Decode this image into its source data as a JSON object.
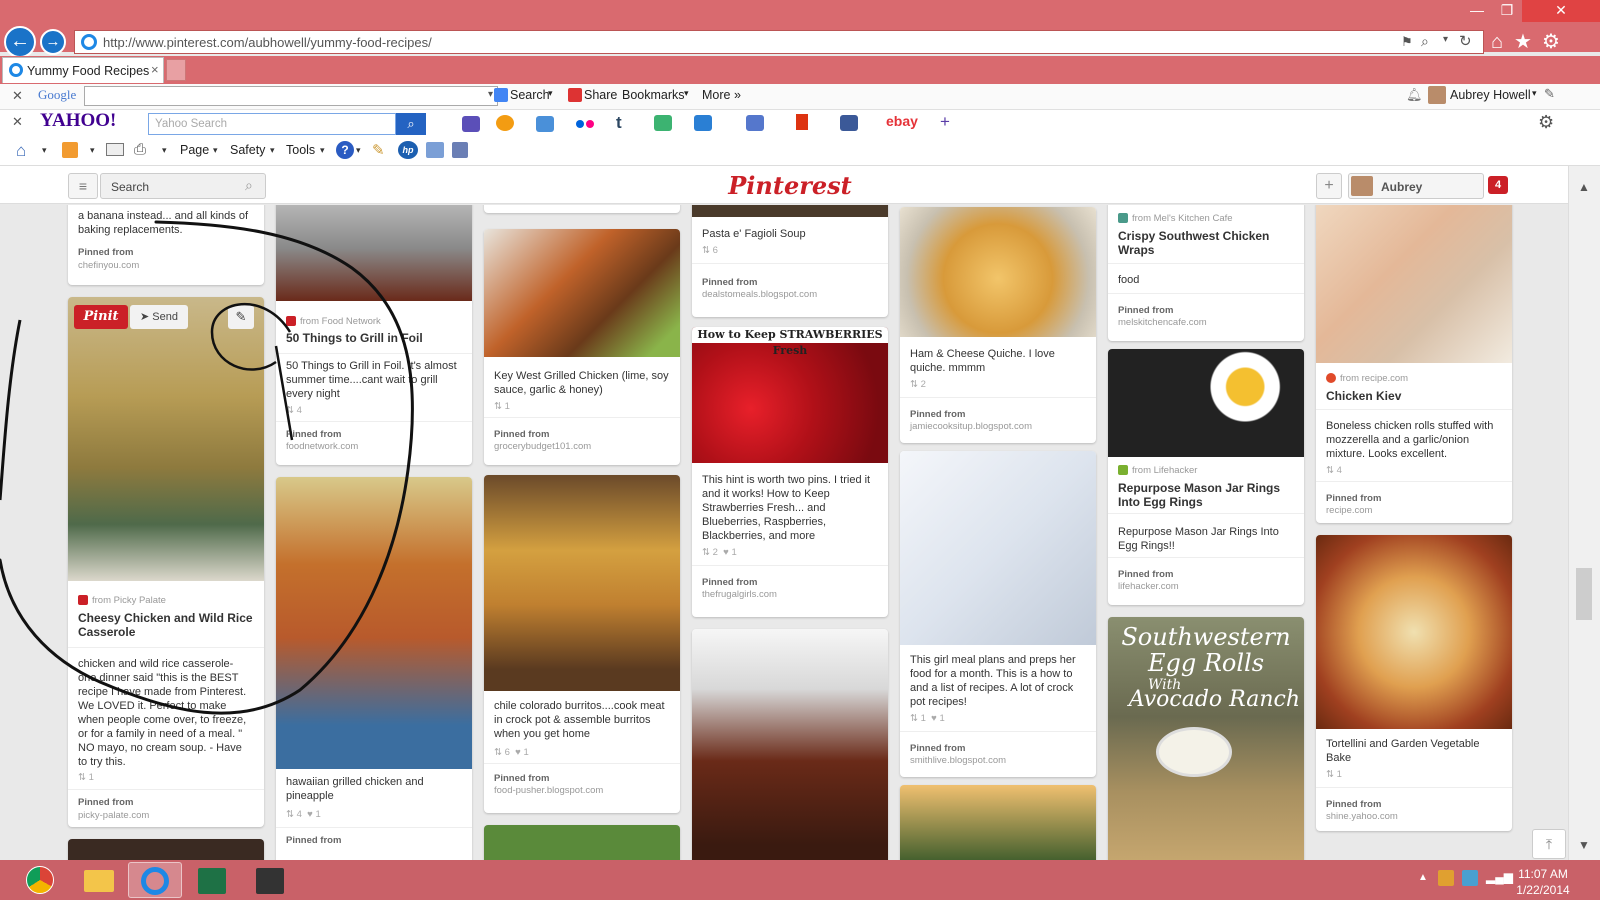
{
  "browser": {
    "url": "http://www.pinterest.com/aubhowell/yummy-food-recipes/",
    "tab_title": "Yummy Food Recipes",
    "tab_close": "×"
  },
  "google_bar": {
    "logo": "Google",
    "search_label": "Search",
    "share_label": "Share",
    "bookmarks_label": "Bookmarks",
    "more_label": "More »",
    "user_name": "Aubrey Howell"
  },
  "yahoo_bar": {
    "logo": "YAHOO!",
    "search_placeholder": "Yahoo Search",
    "ebay_label": "ebay"
  },
  "command_bar": {
    "page_label": "Page",
    "safety_label": "Safety",
    "tools_label": "Tools"
  },
  "pinterest": {
    "logo": "Pinterest",
    "search_label": "Search",
    "user_name": "Aubrey",
    "notification_count": "4",
    "pinit_label": "Pinit",
    "send_label": "Send"
  },
  "pins": {
    "c1a": {
      "desc": "a banana instead... and all kinds of baking replacements.",
      "pinned_from": "Pinned from",
      "url": "chefinyou.com"
    },
    "c1b": {
      "source": "from Picky Palate",
      "title": "Cheesy Chicken and Wild Rice Casserole",
      "desc": "chicken and wild rice casserole- one dinner said \"this is the BEST recipe I have made from Pinterest. We LOVED it. Perfect to make when people come over, to freeze, or for a family in need of a meal. \" NO mayo, no cream soup. - Have to try this.",
      "repins": "1",
      "pinned_from": "Pinned from",
      "url": "picky-palate.com"
    },
    "c2a": {
      "source": "from Food Network",
      "title": "50 Things to Grill in Foil",
      "desc": "50 Things to Grill in Foil. It's almost summer time....cant wait to grill every night",
      "repins": "4",
      "pinned_from": "Pinned from",
      "url": "foodnetwork.com"
    },
    "c2b": {
      "desc": "hawaiian grilled chicken and pineapple",
      "repins": "4",
      "likes": "1",
      "pinned_from": "Pinned from"
    },
    "c3a": {
      "desc": "Key West Grilled Chicken (lime, soy sauce, garlic & honey)",
      "repins": "1",
      "pinned_from": "Pinned from",
      "url": "grocerybudget101.com"
    },
    "c3b": {
      "desc": "chile colorado burritos....cook meat in crock pot & assemble burritos when you get home",
      "repins": "6",
      "likes": "1",
      "pinned_from": "Pinned from",
      "url": "food-pusher.blogspot.com"
    },
    "c4a": {
      "desc": "Pasta e' Fagioli Soup",
      "repins": "6",
      "pinned_from": "Pinned from",
      "url": "dealstomeals.blogspot.com"
    },
    "c4b": {
      "banner": "How to Keep STRAWBERRIES Fresh",
      "desc": "This hint is worth two pins. I tried it and it works! How to Keep Strawberries Fresh... and Blueberries, Raspberries, Blackberries, and more",
      "repins": "2",
      "likes": "1",
      "pinned_from": "Pinned from",
      "url": "thefrugalgirls.com"
    },
    "c5a": {
      "desc": "Ham & Cheese Quiche. I love quiche. mmmm",
      "repins": "2",
      "pinned_from": "Pinned from",
      "url": "jamiecooksitup.blogspot.com"
    },
    "c5b": {
      "desc": "This girl meal plans and preps her food for a month. This is a how to and a list of recipes. A lot of crock pot recipes!",
      "repins": "1",
      "likes": "1",
      "pinned_from": "Pinned from",
      "url": "smithlive.blogspot.com"
    },
    "c6a": {
      "source": "from Mel's Kitchen Cafe",
      "title": "Crispy Southwest Chicken Wraps",
      "desc": "food",
      "pinned_from": "Pinned from",
      "url": "melskitchencafe.com"
    },
    "c6b": {
      "source": "from Lifehacker",
      "title": "Repurpose Mason Jar Rings Into Egg Rings",
      "desc": "Repurpose Mason Jar Rings Into Egg Rings!!",
      "pinned_from": "Pinned from",
      "url": "lifehacker.com"
    },
    "c6c": {
      "overlay1": "Southwestern",
      "overlay2": "Egg Rolls",
      "overlay3": "With",
      "overlay4": "Avocado Ranch"
    },
    "c7a": {
      "source": "from recipe.com",
      "title": "Chicken Kiev",
      "desc": "Boneless chicken rolls stuffed with mozzerella and a garlic/onion mixture. Looks excellent.",
      "repins": "4",
      "pinned_from": "Pinned from",
      "url": "recipe.com"
    },
    "c7b": {
      "desc": "Tortellini and Garden Vegetable Bake",
      "repins": "1",
      "pinned_from": "Pinned from",
      "url": "shine.yahoo.com"
    }
  },
  "taskbar": {
    "time": "11:07 AM",
    "date": "1/22/2014"
  },
  "colors": {
    "window_chrome": "#d96a6f",
    "pinterest_red": "#cb2027",
    "taskbar": "#c96168"
  }
}
